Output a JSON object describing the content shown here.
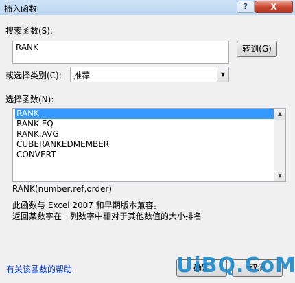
{
  "window": {
    "title": "插入函数",
    "help_glyph": "?",
    "close_glyph": "X"
  },
  "search": {
    "label": "搜索函数(S):",
    "value": "RANK",
    "go_button": "转到(G)"
  },
  "category": {
    "label": "或选择类别(C):",
    "selected": "推荐",
    "arrow_icon": "▼"
  },
  "functions": {
    "label": "选择函数(N):",
    "items": [
      "RANK",
      "RANK.EQ",
      "RANK.AVG",
      "CUBERANKEDMEMBER",
      "CONVERT"
    ],
    "selected_index": 0,
    "scroll_up_icon": "▲",
    "scroll_down_icon": "▼"
  },
  "description": {
    "signature": "RANK(number,ref,order)",
    "line1": "此函数与 Excel 2007 和早期版本兼容。",
    "line2": "返回某数字在一列数字中相对于其他数值的大小排名"
  },
  "footer": {
    "help_link": "有关该函数的帮助",
    "ok": "确定",
    "cancel": "取消"
  },
  "watermark": "UiBQ.CoM",
  "colors": {
    "selection": "#3399ff",
    "link": "#0033cc",
    "titlebar": "#c4dbf3",
    "watermark": "#1f8ed0"
  }
}
